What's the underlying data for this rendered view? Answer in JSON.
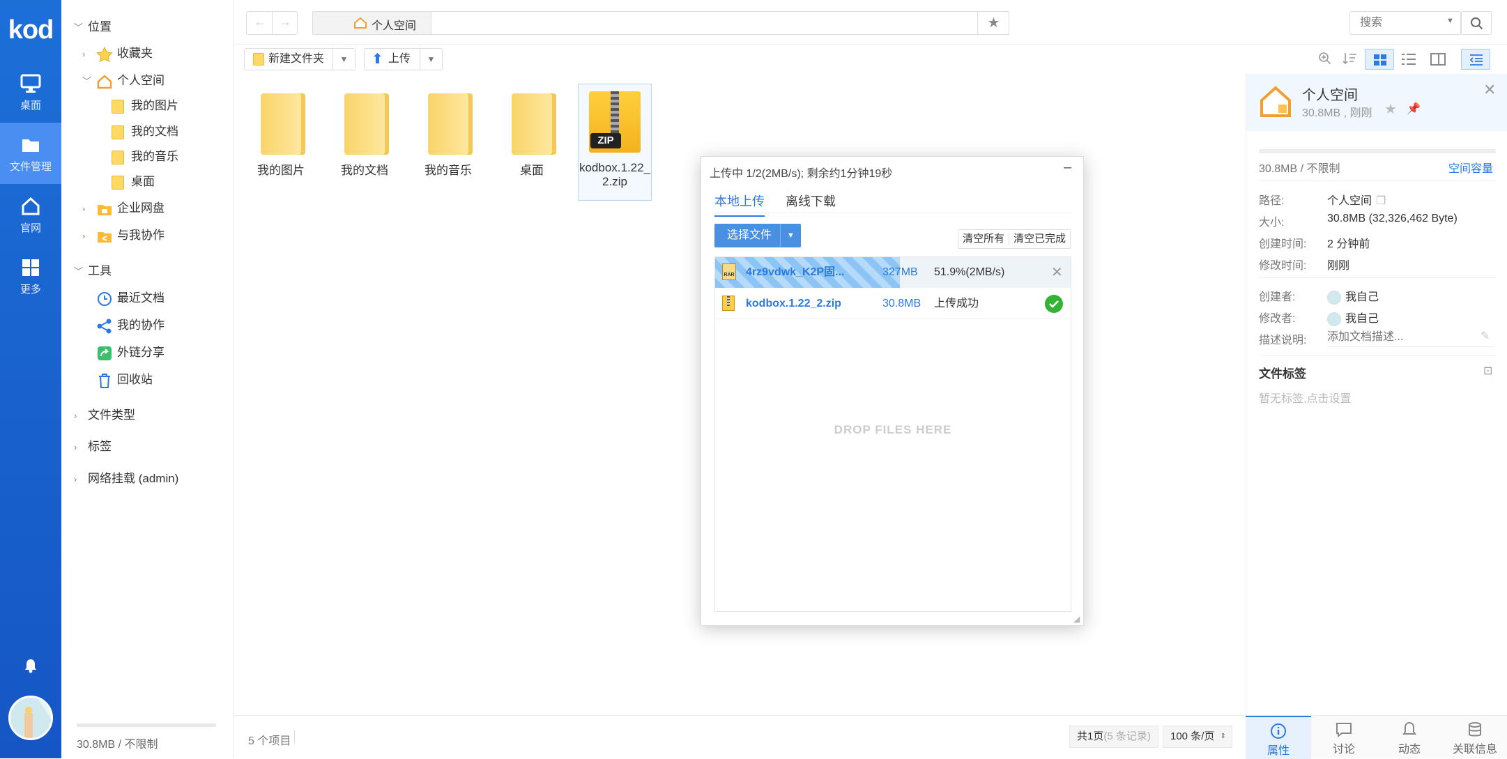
{
  "app": {
    "logo": "kod"
  },
  "appnav": [
    {
      "label": "桌面",
      "icon": "desktop-icon"
    },
    {
      "label": "文件管理",
      "icon": "folder-icon",
      "active": true
    },
    {
      "label": "官网",
      "icon": "home-icon"
    },
    {
      "label": "更多",
      "icon": "grid-icon"
    }
  ],
  "tree": {
    "location": "位置",
    "favorites": "收藏夹",
    "personal": "个人空间",
    "sub": [
      "我的图片",
      "我的文档",
      "我的音乐",
      "桌面"
    ],
    "enterprise": "企业网盘",
    "collab": "与我协作",
    "tools": "工具",
    "recent": "最近文档",
    "mycollab": "我的协作",
    "share": "外链分享",
    "recycle": "回收站",
    "filetypes": "文件类型",
    "tags": "标签",
    "netmount": "网络挂载 (admin)",
    "usage": "30.8MB / 不限制"
  },
  "topbar": {
    "breadcrumb": "个人空间",
    "search_placeholder": "搜索"
  },
  "toolbar": {
    "new_folder": "新建文件夹",
    "upload": "上传"
  },
  "files": [
    {
      "name": "我的图片",
      "type": "folder"
    },
    {
      "name": "我的文档",
      "type": "folder"
    },
    {
      "name": "我的音乐",
      "type": "folder"
    },
    {
      "name": "桌面",
      "type": "folder"
    },
    {
      "name": "kodbox.1.22_2.zip",
      "type": "zip",
      "line1": "kodbox.1.22_",
      "line2": "2.zip",
      "badge": "ZIP"
    }
  ],
  "status": {
    "count": "5 个项目",
    "pages": "共1页",
    "records": "(5 条记录)",
    "per_page": "100 条/页"
  },
  "props": {
    "title": "个人空间",
    "subtitle": "30.8MB , 刚刚",
    "quota": "30.8MB / 不限制",
    "quota_link": "空间容量",
    "path_k": "路径:",
    "path_v": "个人空间",
    "size_k": "大小:",
    "size_v": "30.8MB (32,326,462 Byte)",
    "created_k": "创建时间:",
    "created_v": "2 分钟前",
    "modified_k": "修改时间:",
    "modified_v": "刚刚",
    "creator_k": "创建者:",
    "creator_v": "我自己",
    "modifier_k": "修改者:",
    "modifier_v": "我自己",
    "desc_k": "描述说明:",
    "desc_placeholder": "添加文档描述...",
    "tags_title": "文件标签",
    "tags_empty": "暂无标签,点击设置"
  },
  "rtabs": [
    {
      "label": "属性",
      "icon": "info-icon",
      "active": true
    },
    {
      "label": "讨论",
      "icon": "chat-icon"
    },
    {
      "label": "动态",
      "icon": "bell-icon"
    },
    {
      "label": "关联信息",
      "icon": "database-icon"
    }
  ],
  "upload": {
    "title": "上传中 1/2(2MB/s); 剩余约1分钟19秒",
    "tab_local": "本地上传",
    "tab_offline": "离线下载",
    "choose": "选择文件",
    "clear_all": "清空所有",
    "clear_done": "清空已完成",
    "drop": "DROP FILES HERE",
    "items": [
      {
        "name": "4rz9vdwk_K2P固...",
        "size": "327MB",
        "status": "51.9%(2MB/s)",
        "progress": 0.519,
        "badge": "RAR"
      },
      {
        "name": "kodbox.1.22_2.zip",
        "size": "30.8MB",
        "status": "上传成功",
        "progress": 1.0
      }
    ]
  },
  "colors": {
    "accent": "#2a7ae2",
    "appbar": "#1d6fd8",
    "success": "#34b233",
    "folder": "#ffd866"
  }
}
